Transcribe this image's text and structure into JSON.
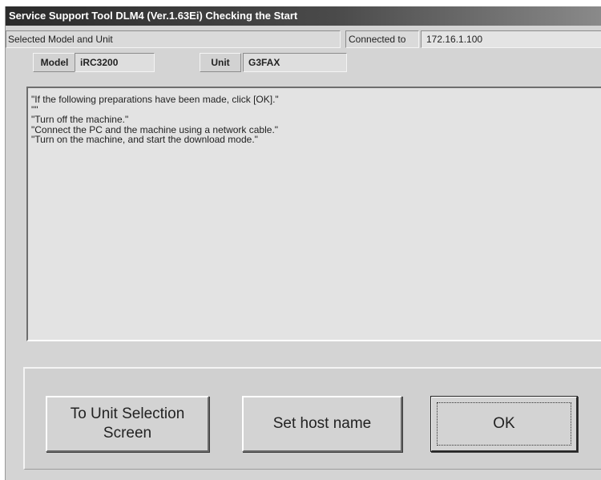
{
  "window": {
    "title": "Service Support Tool DLM4 (Ver.1.63Ei) Checking the Start"
  },
  "status_bar": {
    "selected_label": "Selected Model and Unit",
    "connected_label": "Connected to",
    "ip_address": "172.16.1.100"
  },
  "selection": {
    "model_label": "Model",
    "model_value": "iRC3200",
    "unit_label": "Unit",
    "unit_value": "G3FAX"
  },
  "message": {
    "lines": [
      "\"If the following preparations have been made, click [OK].\"",
      "\"\"",
      "\"Turn off the machine.\"",
      "\"Connect the PC and the machine using a network cable.\"",
      "\"Turn on the machine, and start the download mode.\""
    ]
  },
  "buttons": {
    "unit_selection": "To Unit Selection Screen",
    "set_host_name": "Set host name",
    "ok": "OK"
  }
}
